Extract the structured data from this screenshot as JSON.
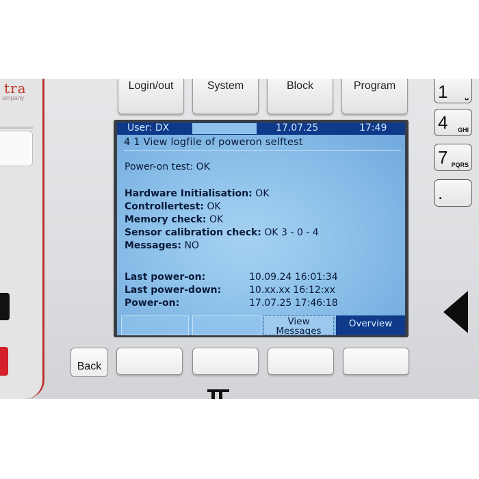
{
  "brand": {
    "name": "tra",
    "sub": "ompany"
  },
  "top_keys": [
    "Login/out",
    "System",
    "Block",
    "Program"
  ],
  "keypad": [
    {
      "digit": "1",
      "letters": "␣"
    },
    {
      "digit": "4",
      "letters": "GHI"
    },
    {
      "digit": "7",
      "letters": "PQRS"
    },
    {
      "digit": ".",
      "letters": ""
    }
  ],
  "back_label": "Back",
  "lcd": {
    "status": {
      "user": "User:  DX",
      "date": "17.07.25",
      "time": "17:49"
    },
    "title": "4 1 View logfile of poweron selftest",
    "power_on_test": "Power-on test: OK",
    "checks": [
      {
        "label": "Hardware Initialisation:",
        "value": "OK"
      },
      {
        "label": "Controllertest:",
        "value": "OK"
      },
      {
        "label": "Memory check:",
        "value": "OK"
      },
      {
        "label": "Sensor calibration check:",
        "value": "OK  3 - 0 - 4"
      },
      {
        "label": "Messages:",
        "value": "NO"
      }
    ],
    "times": [
      {
        "label": "Last power-on:",
        "value": "10.09.24  16:01:34"
      },
      {
        "label": "Last power-down:",
        "value": "10.xx.xx  16:12:xx"
      },
      {
        "label": "Power-on:",
        "value": "17.07.25  17:46:18"
      }
    ],
    "softkeys": [
      "",
      "",
      "View Messages",
      "Overview"
    ]
  },
  "colors": {
    "lcd_bar": "#0f3a8a",
    "lcd_bg": "#8dc1ea",
    "brand_red": "#c0392b"
  }
}
